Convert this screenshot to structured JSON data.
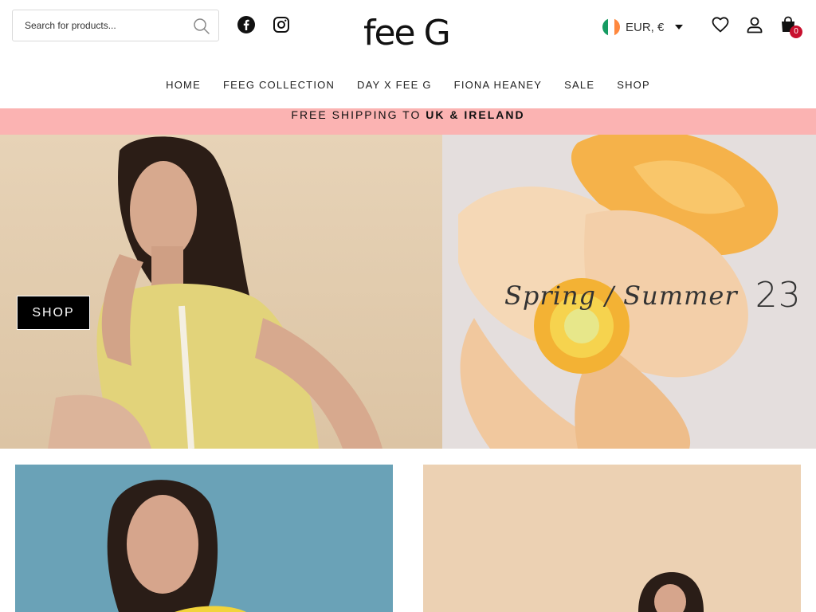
{
  "search": {
    "placeholder": "Search for products..."
  },
  "brand": {
    "logo_text": "fee G"
  },
  "currency": {
    "label": "EUR, €",
    "flag_colors": [
      "#169b62",
      "#ffffff",
      "#ff883e"
    ]
  },
  "cart": {
    "count": "0"
  },
  "icons": {
    "search": "search-icon",
    "facebook": "facebook-icon",
    "instagram": "instagram-icon",
    "wishlist": "heart-icon",
    "account": "user-icon",
    "cart": "shopping-bag-icon",
    "currency_dropdown": "caret-down-icon"
  },
  "nav": {
    "items": [
      "HOME",
      "FEEG COLLECTION",
      "DAY X FEE G",
      "FIONA HEANEY",
      "SALE",
      "SHOP"
    ]
  },
  "announcement": {
    "prefix": "FREE SHIPPING TO ",
    "highlight": "UK & IRELAND",
    "background": "#fbb3b2"
  },
  "hero": {
    "button_label": "SHOP",
    "season_text": "Spring / Summer",
    "season_year": "23"
  },
  "colors": {
    "accent": "#c8102e",
    "announcement_bg": "#fbb3b2"
  }
}
